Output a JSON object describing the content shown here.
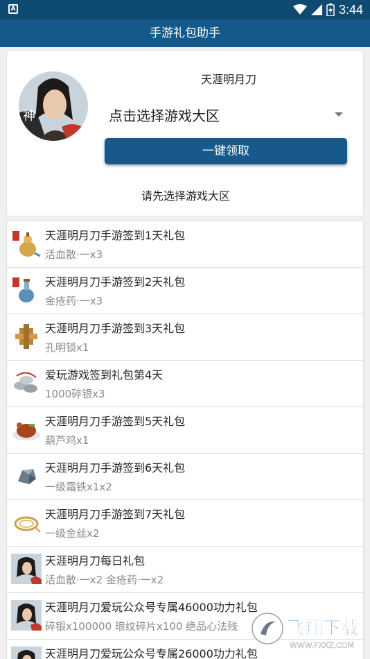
{
  "status_bar": {
    "time": "3:44",
    "notification_icon": "A"
  },
  "app_bar": {
    "title": "手游礼包助手"
  },
  "header": {
    "game_name": "天涯明月刀",
    "region_select_text": "点击选择游戏大区",
    "claim_button_label": "一键领取",
    "hint": "请先选择游戏大区"
  },
  "gifts": [
    {
      "title": "天涯明月刀手游签到1天礼包",
      "items": "活血散·一x3",
      "icon": "gourd-potion-icon"
    },
    {
      "title": "天涯明月刀手游签到2天礼包",
      "items": "金疮药·一x3",
      "icon": "blue-potion-icon"
    },
    {
      "title": "天涯明月刀手游签到3天礼包",
      "items": "孔明锁x1",
      "icon": "puzzle-lock-icon"
    },
    {
      "title": "爱玩游戏签到礼包第4天",
      "items": "1000碎银x3",
      "icon": "silver-coins-icon"
    },
    {
      "title": "天涯明月刀手游签到5天礼包",
      "items": "葫芦鸡x1",
      "icon": "roast-chicken-icon"
    },
    {
      "title": "天涯明月刀手游签到6天礼包",
      "items": "一级霜铁x1x2",
      "icon": "iron-ore-icon"
    },
    {
      "title": "天涯明月刀手游签到7天礼包",
      "items": "一级金丝x2",
      "icon": "gold-thread-icon"
    },
    {
      "title": "天涯明月刀每日礼包",
      "items": "活血散·一x2 金疮药·一x2",
      "icon": "game-avatar-icon"
    },
    {
      "title": "天涯明月刀爱玩公众号专属46000功力礼包",
      "items": "碎银x100000 琅纹碎片x100 绝品心法残",
      "icon": "game-avatar-icon"
    },
    {
      "title": "天涯明月刀爱玩公众号专属26000功力礼包",
      "items": "",
      "icon": "game-avatar-icon"
    }
  ],
  "watermark": {
    "text": "飞翔下载",
    "url": "WWW.FXXZ.COM"
  },
  "colors": {
    "primary": "#14598a",
    "status_bar": "#0f4a72",
    "background": "#f0f0f0"
  }
}
